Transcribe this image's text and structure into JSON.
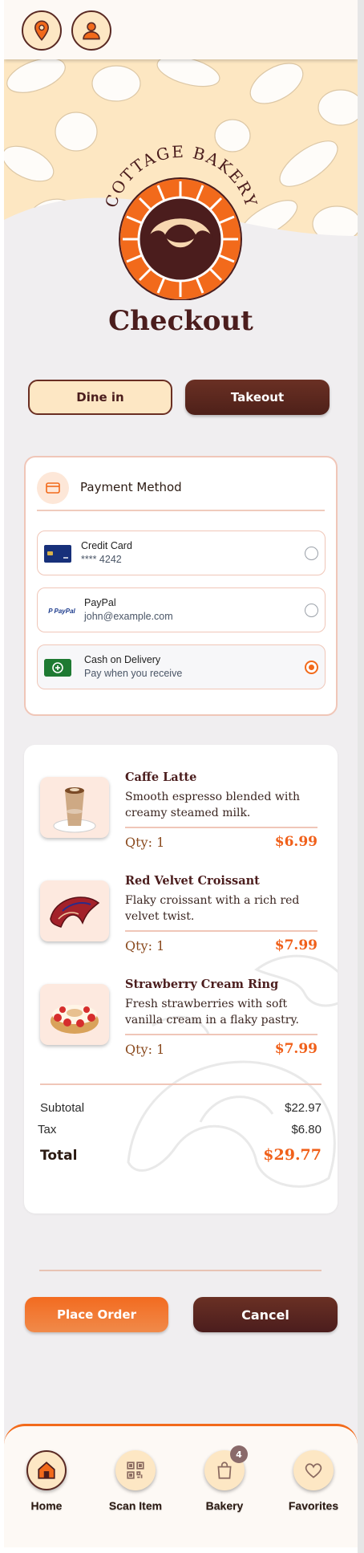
{
  "header": {
    "location_icon": "map-pin-icon",
    "profile_icon": "user-icon"
  },
  "logo": {
    "text": "COTTAGE BAKERY"
  },
  "page": {
    "title": "Checkout"
  },
  "order_mode": {
    "options": [
      "Dine in",
      "Takeout"
    ],
    "selected": "Takeout"
  },
  "payment": {
    "heading": "Payment Method",
    "methods": [
      {
        "title": "Credit Card",
        "subtitle": "**** 4242",
        "logo": "credit-card-icon",
        "selected": false
      },
      {
        "title": "PayPal",
        "subtitle": "john@example.com",
        "logo": "paypal-icon",
        "logo_text": "PayPal",
        "selected": false
      },
      {
        "title": "Cash on Delivery",
        "subtitle": "Pay when you receive",
        "logo": "cash-icon",
        "selected": true
      }
    ]
  },
  "order": {
    "items": [
      {
        "name": "Caffe Latte",
        "description": "Smooth espresso blended with creamy steamed milk.",
        "qty": "Qty: 1",
        "price": "$6.99"
      },
      {
        "name": "Red Velvet Croissant",
        "description": "Flaky croissant with a rich red velvet twist.",
        "qty": "Qty: 1",
        "price": "$7.99"
      },
      {
        "name": "Strawberry Cream Ring",
        "description": "Fresh strawberries with soft vanilla cream in a flaky pastry.",
        "qty": "Qty: 1",
        "price": "$7.99"
      }
    ],
    "subtotal_label": "Subtotal",
    "subtotal": "$22.97",
    "tax_label": "Tax",
    "tax": "$6.80",
    "total_label": "Total",
    "total": "$29.77"
  },
  "actions": {
    "place_order": "Place Order",
    "cancel": "Cancel"
  },
  "nav": {
    "items": [
      {
        "label": "Home",
        "icon": "home-icon",
        "active": true
      },
      {
        "label": "Scan Item",
        "icon": "qr-code-icon",
        "active": false
      },
      {
        "label": "Bakery",
        "icon": "shopping-bag-icon",
        "badge": "4",
        "active": false
      },
      {
        "label": "Favorites",
        "icon": "heart-icon",
        "active": false
      }
    ]
  },
  "colors": {
    "accent": "#f26a1b",
    "brown": "#4b1d1d",
    "cream": "#fde7c4"
  }
}
